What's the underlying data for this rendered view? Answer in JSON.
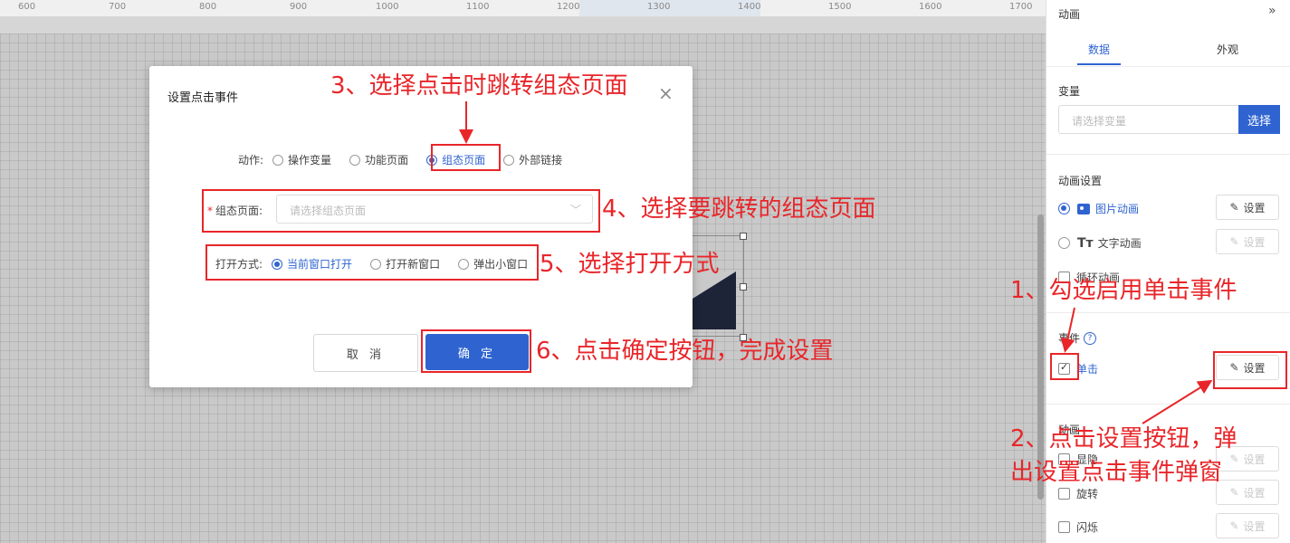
{
  "ruler": {
    "ticks": [
      "600",
      "700",
      "800",
      "900",
      "1000",
      "1100",
      "1200",
      "1300",
      "1400",
      "1500",
      "1600",
      "1700"
    ]
  },
  "modal": {
    "title": "设置点击事件",
    "action_label": "动作:",
    "actions": [
      "操作变量",
      "功能页面",
      "组态页面",
      "外部链接"
    ],
    "selected_action": "组态页面",
    "page_label": "组态页面:",
    "page_placeholder": "请选择组态页面",
    "open_label": "打开方式:",
    "open_modes": [
      "当前窗口打开",
      "打开新窗口",
      "弹出小窗口"
    ],
    "selected_open_mode": "当前窗口打开",
    "cancel_label": "取 消",
    "ok_label": "确 定"
  },
  "panel": {
    "title": "动画",
    "tabs": [
      "数据",
      "外观"
    ],
    "active_tab": "数据",
    "variable_label": "变量",
    "variable_placeholder": "请选择变量",
    "variable_button": "选择",
    "anim_settings_label": "动画设置",
    "image_anim": "图片动画",
    "text_anim": "文字动画",
    "loop_anim": "循环动画",
    "set_label": "设置",
    "event_label": "事件",
    "click_label": "单击",
    "anim_label": "动画",
    "show_hide": "显隐",
    "rotate": "旋转",
    "blink": "闪烁"
  },
  "annotations": {
    "step1": "1、勾选启用单击事件",
    "step2_line1": "2、点击设置按钮，弹",
    "step2_line2": "出设置点击事件弹窗",
    "step3": "3、选择点击时跳转组态页面",
    "step4": "4、选择要跳转的组态页面",
    "step5": "5、选择打开方式",
    "step6": "6、点击确定按钮，完成设置",
    "color": "#e8262a"
  },
  "colors": {
    "accent": "#2f64d0"
  }
}
